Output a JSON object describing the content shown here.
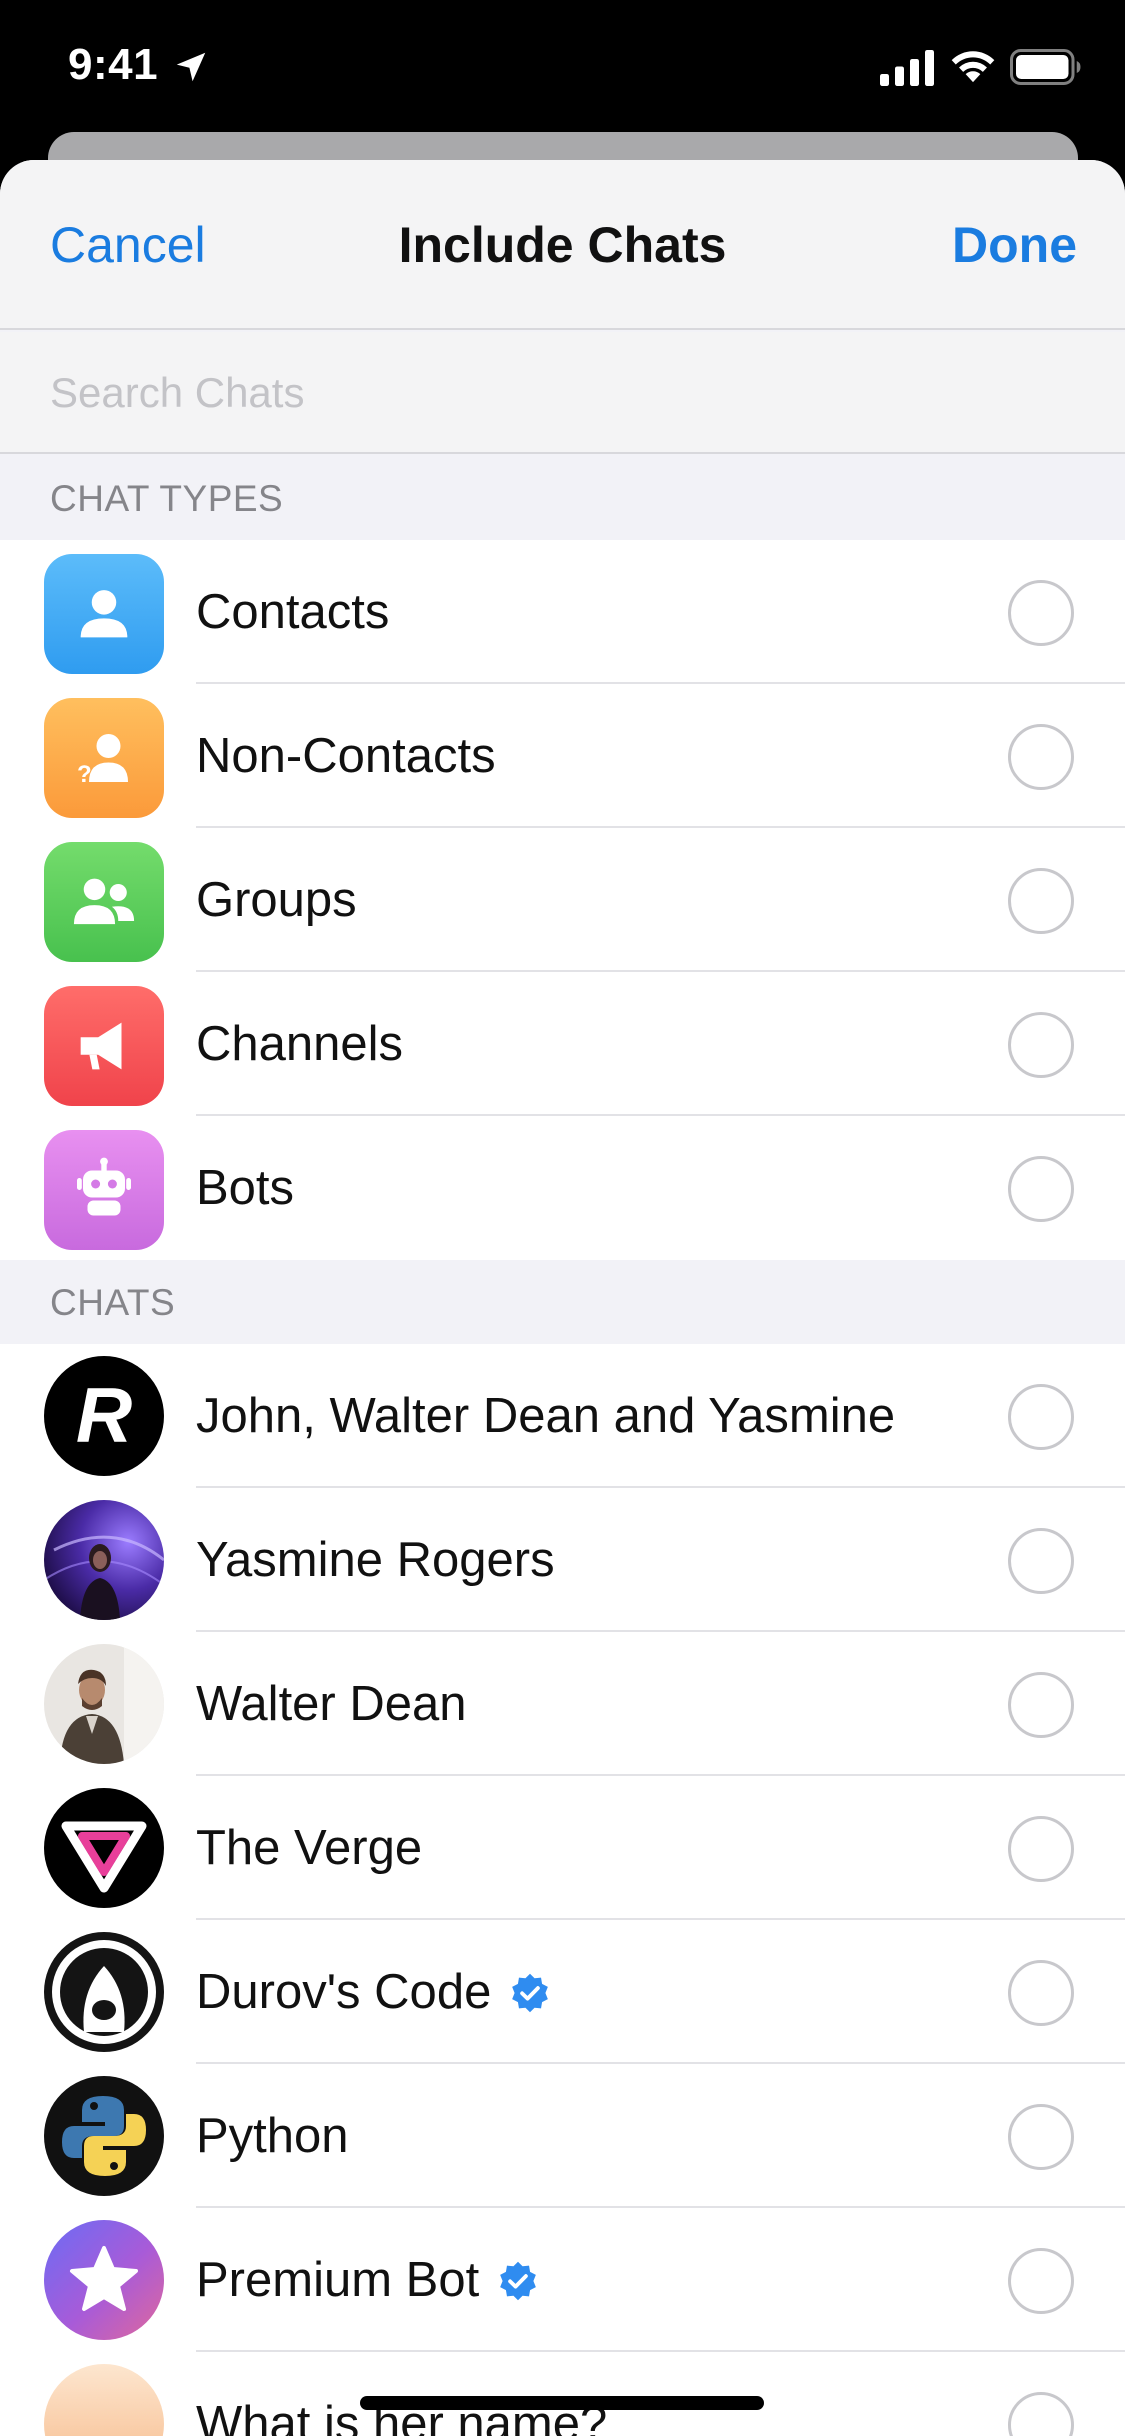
{
  "status_bar": {
    "time": "9:41"
  },
  "header": {
    "cancel_label": "Cancel",
    "title": "Include Chats",
    "done_label": "Done"
  },
  "search": {
    "placeholder": "Search Chats",
    "value": ""
  },
  "sections": {
    "chat_types_header": "CHAT TYPES",
    "chats_header": "CHATS"
  },
  "chat_types": [
    {
      "label": "Contacts",
      "icon": "person-icon",
      "color": "#3ba8f5",
      "selected": false
    },
    {
      "label": "Non-Contacts",
      "icon": "unknown-person-icon",
      "color": "#fca845",
      "selected": false
    },
    {
      "label": "Groups",
      "icon": "group-icon",
      "color": "#5ccf5c",
      "selected": false
    },
    {
      "label": "Channels",
      "icon": "megaphone-icon",
      "color": "#f5555a",
      "selected": false
    },
    {
      "label": "Bots",
      "icon": "robot-icon",
      "color": "#d97ee6",
      "selected": false
    }
  ],
  "chats": [
    {
      "label": "John, Walter Dean and Yasmine",
      "avatar": "r-logo-avatar",
      "verified": false,
      "selected": false
    },
    {
      "label": "Yasmine Rogers",
      "avatar": "photo-avatar-purple",
      "verified": false,
      "selected": false
    },
    {
      "label": "Walter Dean",
      "avatar": "photo-avatar-man",
      "verified": false,
      "selected": false
    },
    {
      "label": "The Verge",
      "avatar": "verge-logo-avatar",
      "verified": false,
      "selected": false
    },
    {
      "label": "Durov's Code",
      "avatar": "penguin-logo-avatar",
      "verified": true,
      "selected": false
    },
    {
      "label": "Python",
      "avatar": "python-logo-avatar",
      "verified": false,
      "selected": false
    },
    {
      "label": "Premium Bot",
      "avatar": "star-avatar",
      "verified": true,
      "selected": false
    },
    {
      "label": "What is her name?",
      "avatar": "peach-avatar",
      "verified": false,
      "selected": false
    }
  ],
  "colors": {
    "accent": "#1a7ce0",
    "verified": "#2f8cf0"
  }
}
